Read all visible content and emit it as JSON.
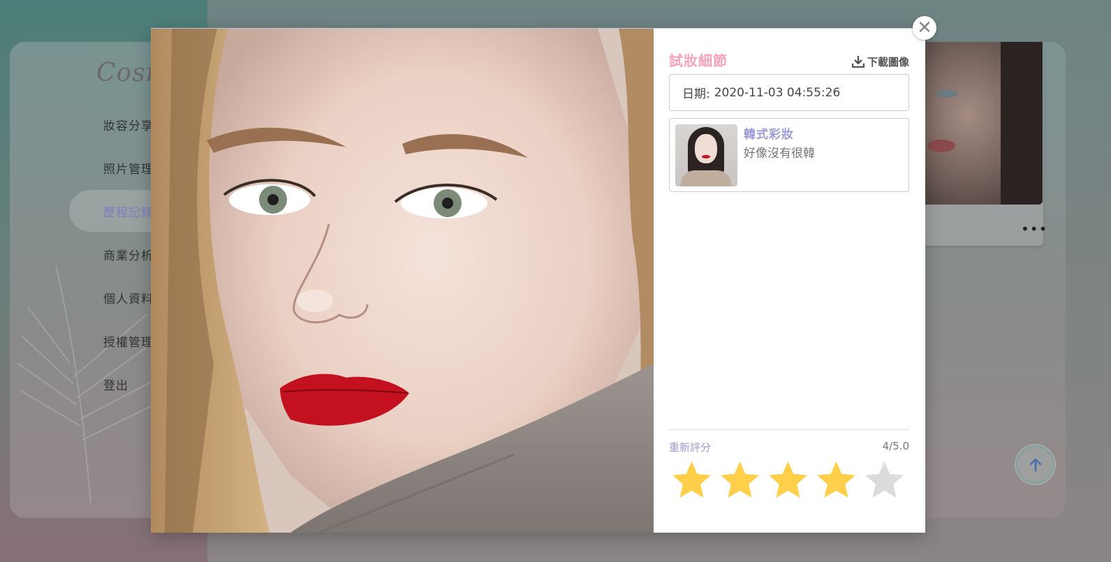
{
  "brand": {
    "name": "Cosm"
  },
  "sidebar": {
    "items": [
      {
        "label": "妝容分享"
      },
      {
        "label": "照片管理"
      },
      {
        "label": "歷程記錄"
      },
      {
        "label": "商業分析"
      },
      {
        "label": "個人資料"
      },
      {
        "label": "授權管理"
      },
      {
        "label": "登出"
      }
    ],
    "active_index": 2
  },
  "background_card": {
    "more_label": "•••"
  },
  "modal": {
    "title": "試妝細節",
    "download_label": "下載圖像",
    "date_label": "日期:",
    "date_value": "2020-11-03 04:55:26",
    "makeup": {
      "name": "韓式彩妝",
      "comment": "好像沒有很韓"
    },
    "rating": {
      "label": "重新評分",
      "score_text": "4/5.0",
      "value": 4,
      "max": 5
    }
  },
  "colors": {
    "accent_pink": "#f7a2b8",
    "accent_purple": "#9b9ad6",
    "star_filled": "#ffcf4a",
    "star_empty": "#dcdcdc"
  },
  "icons": {
    "close": "close-icon",
    "download": "download-icon",
    "scroll_top": "arrow-up-icon",
    "more": "more-horizontal-icon"
  }
}
